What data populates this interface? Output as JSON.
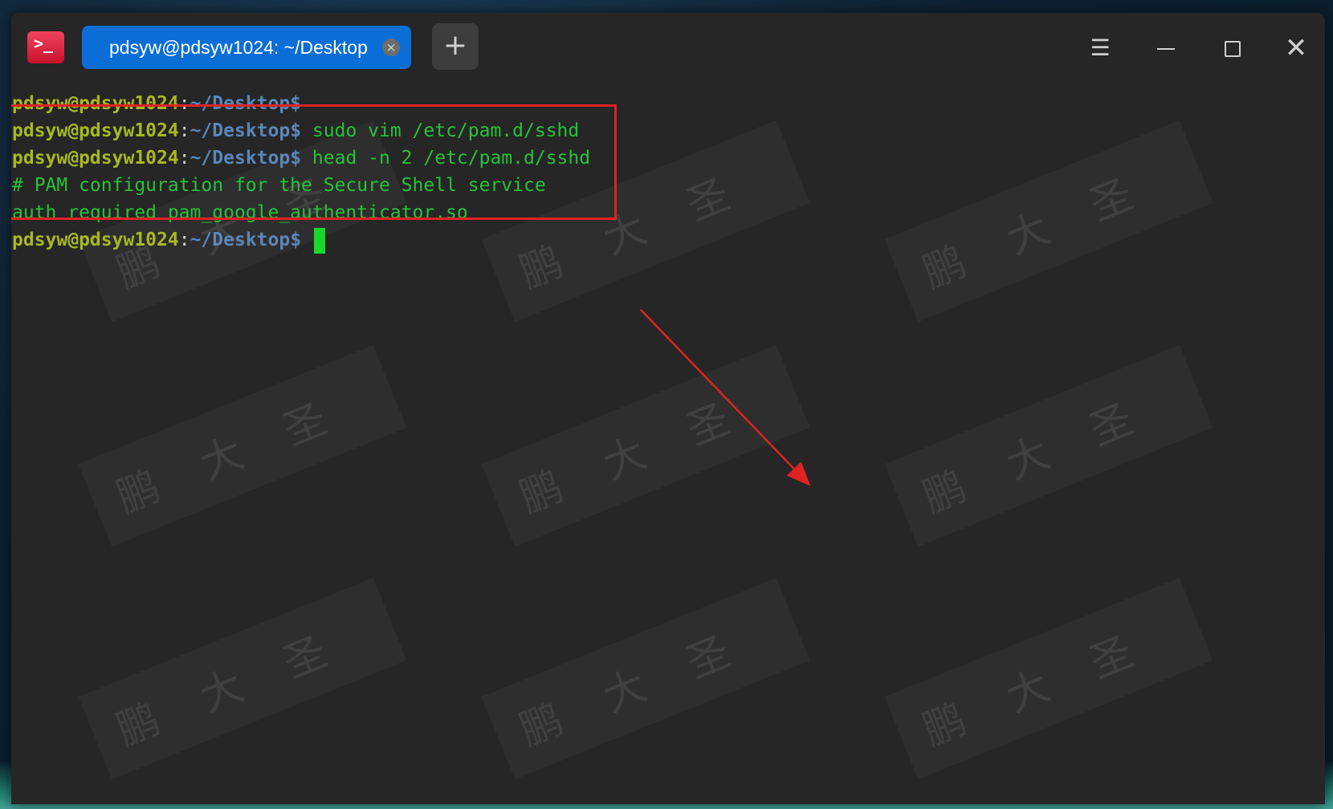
{
  "window": {
    "app_icon_glyph": ">_",
    "tab_title": "pdsyw@pdsyw1024: ~/Desktop",
    "tab_close_glyph": "×",
    "new_tab_glyph": "+",
    "menu_glyph": "☰",
    "close_glyph": "✕"
  },
  "terminal": {
    "user_host": "pdsyw@pdsyw1024",
    "colon": ":",
    "path": "~/Desktop$",
    "lines": [
      {
        "kind": "prompt",
        "command": ""
      },
      {
        "kind": "prompt",
        "command": " sudo vim /etc/pam.d/sshd"
      },
      {
        "kind": "prompt",
        "command": " head -n 2 /etc/pam.d/sshd"
      },
      {
        "kind": "output",
        "text": "# PAM configuration for the Secure Shell service"
      },
      {
        "kind": "output",
        "text": "auth required pam_google_authenticator.so"
      },
      {
        "kind": "prompt",
        "command": " "
      }
    ]
  },
  "watermark": {
    "text": "鹏大圣"
  },
  "colors": {
    "user_host": "#a7b823",
    "path": "#5b86b8",
    "command": "#27c23a",
    "annotation_red": "#e02222",
    "tab_blue": "#0a6ed6"
  }
}
